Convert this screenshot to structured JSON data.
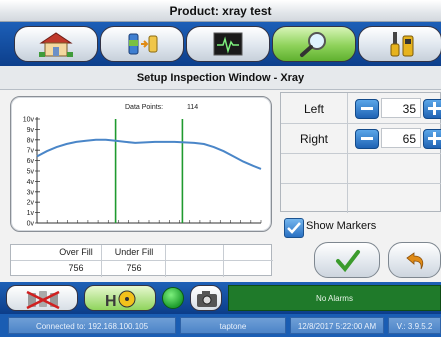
{
  "window": {
    "title": "Product: xray test"
  },
  "nav": {
    "buttons": [
      {
        "icon": "home-icon"
      },
      {
        "icon": "product-transfer-icon"
      },
      {
        "icon": "waveform-monitor-icon"
      },
      {
        "icon": "magnifier-icon",
        "active": true
      },
      {
        "icon": "tools-icon"
      }
    ]
  },
  "section": {
    "title": "Setup Inspection Window - Xray"
  },
  "chart": {
    "data_points_label": "Data Points:",
    "data_points_value": "114"
  },
  "chart_data": {
    "type": "line",
    "y_ticks": [
      "10v",
      "9v",
      "8v",
      "7v",
      "6v",
      "5v",
      "4v",
      "3v",
      "2v",
      "1v",
      "0v"
    ],
    "ylim": [
      0,
      10
    ],
    "xlim": [
      0,
      114
    ],
    "series": [
      {
        "color": "#4a86c8",
        "x": [
          0,
          5,
          10,
          15,
          20,
          25,
          30,
          35,
          40,
          45,
          50,
          55,
          60,
          65,
          70,
          75,
          80,
          85,
          90,
          95,
          100,
          105,
          110,
          114
        ],
        "y": [
          6.4,
          6.9,
          7.3,
          7.6,
          7.8,
          7.9,
          8.0,
          8.0,
          7.9,
          7.8,
          7.7,
          7.75,
          7.8,
          7.8,
          7.8,
          7.75,
          7.7,
          7.6,
          7.3,
          6.9,
          6.4,
          5.9,
          5.5,
          5.2
        ]
      }
    ],
    "markers": [
      {
        "label": "Left",
        "x": 40,
        "color": "#1f9a2f"
      },
      {
        "label": "Right",
        "x": 74,
        "color": "#1f9a2f"
      }
    ]
  },
  "stats": {
    "headers": [
      "Over Fill",
      "Under Fill",
      "",
      ""
    ],
    "values": [
      "756",
      "756",
      "",
      ""
    ]
  },
  "settings": {
    "left": {
      "label": "Left",
      "value": "35"
    },
    "right": {
      "label": "Right",
      "value": "65"
    }
  },
  "show_markers": {
    "label": "Show Markers",
    "checked": true
  },
  "bottom": {
    "alarm_text": "No Alarms"
  },
  "status": {
    "connection": "Connected to: 192.168.100.105",
    "device": "taptone",
    "datetime": "12/8/2017 5:22:00 AM",
    "version": "V.: 3.9.5.2"
  },
  "colors": {
    "accent_blue": "#1a5db3",
    "active_green": "#8ed25a",
    "alarm_green": "#1f7a2a"
  }
}
